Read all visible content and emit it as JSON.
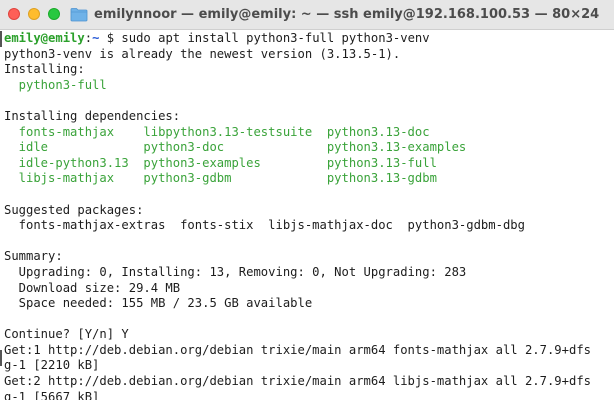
{
  "window": {
    "title": "emilynnoor — emily@emily: ~ — ssh emily@192.168.100.53 — 80×24",
    "icon": "folder-icon"
  },
  "terminal": {
    "prompt_user_host": "emily@emily",
    "prompt_sep": ":",
    "prompt_path": "~",
    "prompt_symbol": " $ ",
    "command": "sudo apt install python3-full python3-venv",
    "output": {
      "already_newest": "python3-venv is already the newest version (3.13.5-1).",
      "installing_header": "Installing:",
      "installing_pkgs": "  python3-full",
      "deps_header": "Installing dependencies:",
      "deps_row1": "  fonts-mathjax    libpython3.13-testsuite  python3.13-doc",
      "deps_row2": "  idle             python3-doc              python3.13-examples",
      "deps_row3": "  idle-python3.13  python3-examples         python3.13-full",
      "deps_row4": "  libjs-mathjax    python3-gdbm             python3.13-gdbm",
      "suggested_header": "Suggested packages:",
      "suggested_pkgs": "  fonts-mathjax-extras  fonts-stix  libjs-mathjax-doc  python3-gdbm-dbg",
      "summary_header": "Summary:",
      "summary_counts": "  Upgrading: 0, Installing: 13, Removing: 0, Not Upgrading: 283",
      "summary_download": "  Download size: 29.4 MB",
      "summary_space": "  Space needed: 155 MB / 23.5 GB available",
      "continue_prompt": "Continue? [Y/n] Y",
      "get1_a": "Get:1 http://deb.debian.org/debian trixie/main arm64 fonts-mathjax all 2.7.9+dfs",
      "get1_b": "g-1 [2210 kB]",
      "get2_a": "Get:2 http://deb.debian.org/debian trixie/main arm64 libjs-mathjax all 2.7.9+dfs",
      "get2_b": "g-1 [5667 kB]"
    }
  },
  "colors": {
    "prompt_user": "#2ba02b",
    "prompt_path": "#2a5bd7",
    "package_green": "#3aa33a",
    "text": "#1d1d1d",
    "titlebar": "#e6e6e6"
  }
}
